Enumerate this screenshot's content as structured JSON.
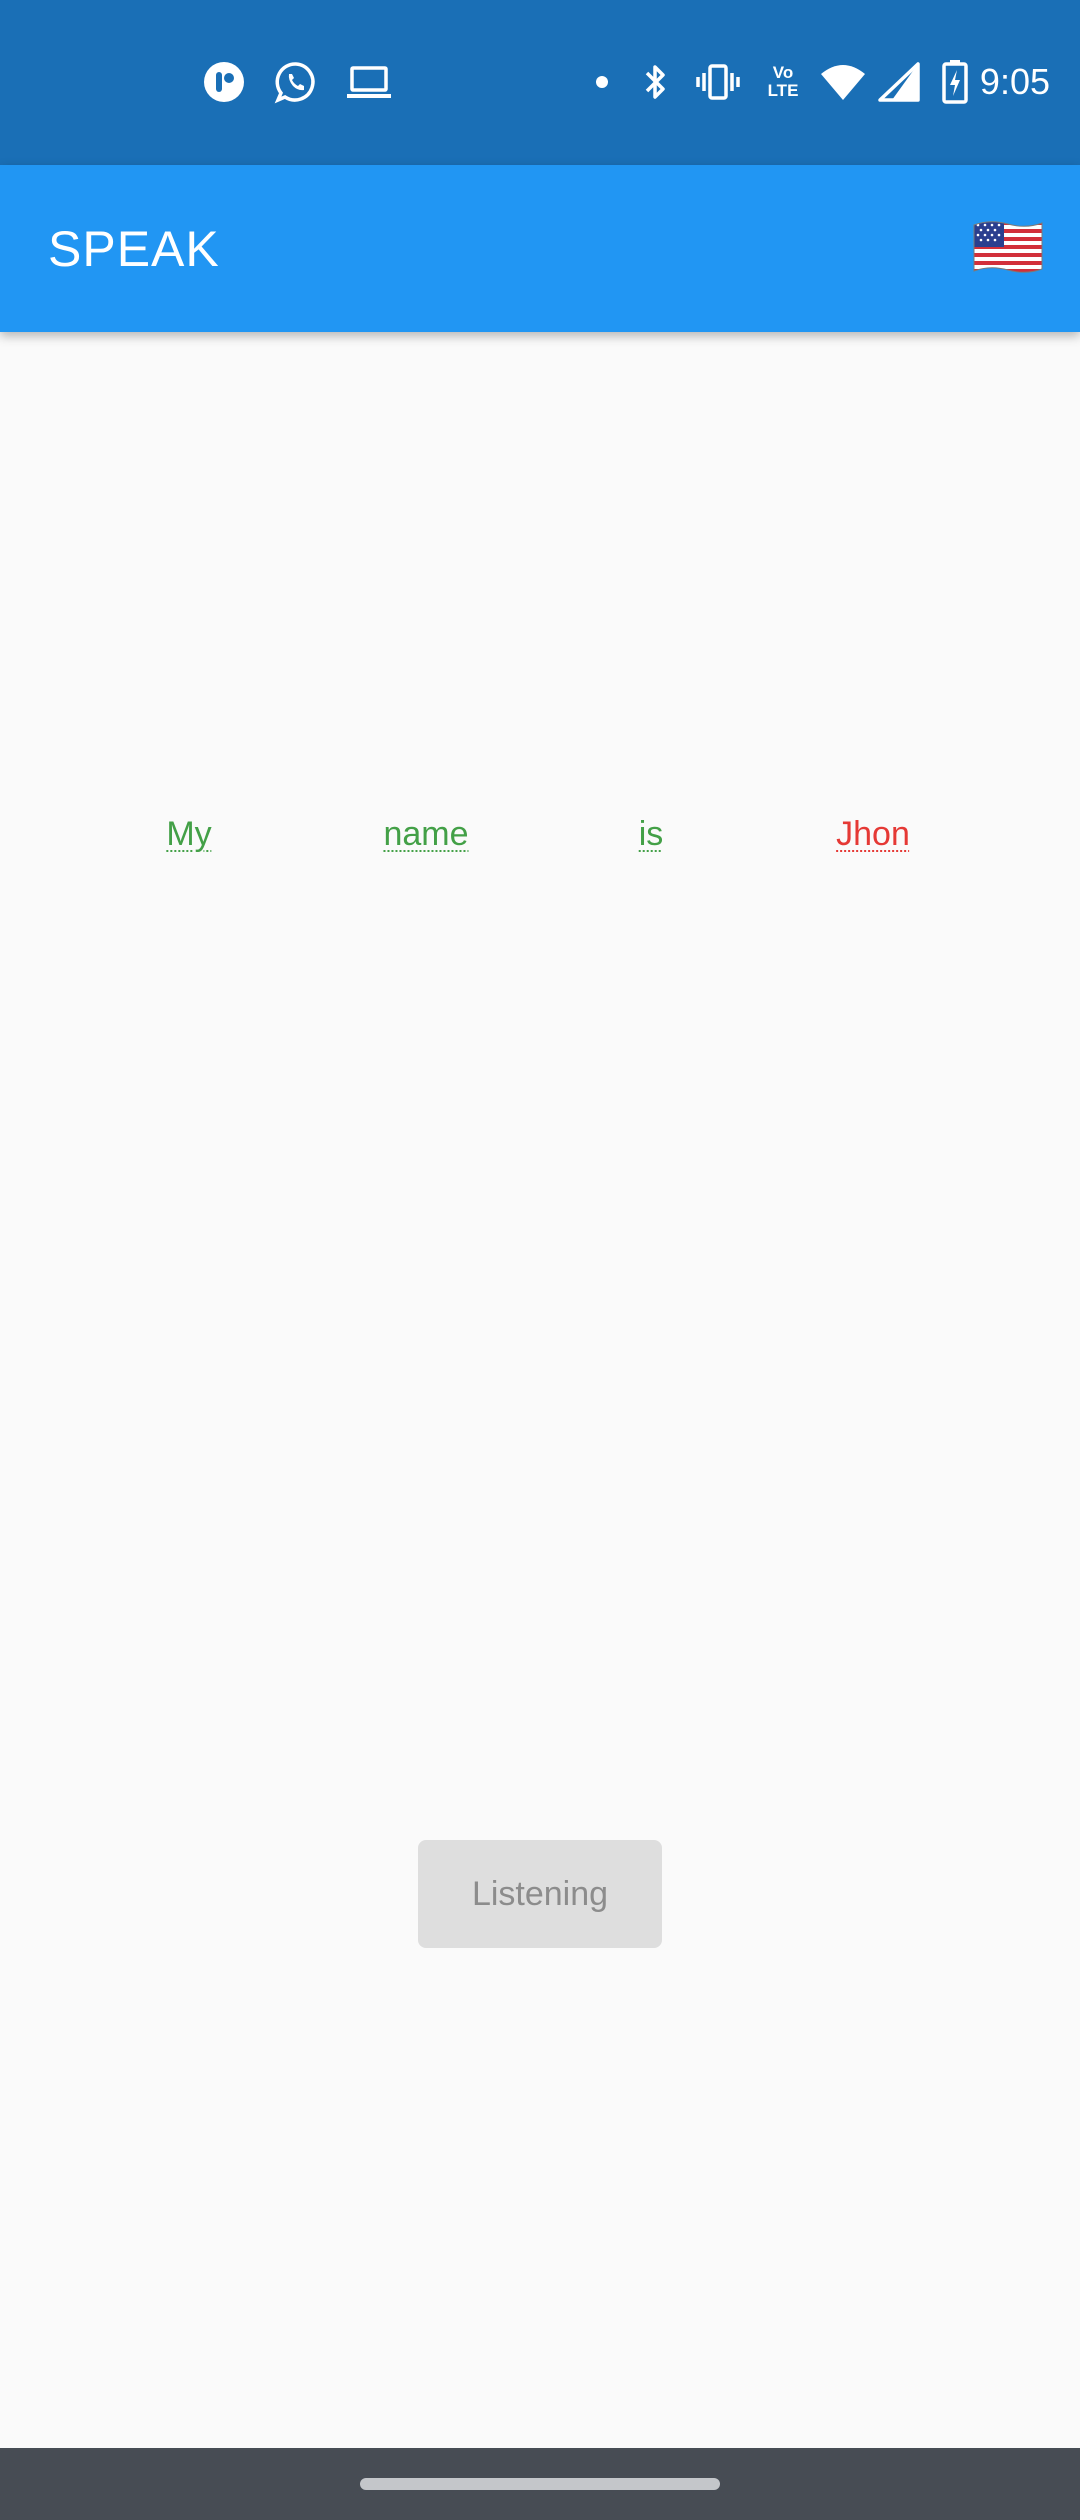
{
  "status_bar": {
    "time": "9:05",
    "left_icons": [
      "app-notification-icon",
      "whatsapp-icon",
      "laptop-icon"
    ],
    "right_icons": [
      "dot-icon",
      "bluetooth-icon",
      "vibrate-icon",
      "volte-icon",
      "wifi-icon",
      "signal-icon",
      "battery-charging-icon"
    ],
    "volte_label": "Vo LTE",
    "bg_color": "#1a6fb6"
  },
  "app_bar": {
    "title": "SPEAK",
    "language_flag": "us-flag-icon",
    "bg_color": "#2196f3"
  },
  "main": {
    "words": [
      {
        "text": "My",
        "status": "correct",
        "color": "#43a047"
      },
      {
        "text": "name",
        "status": "correct",
        "color": "#43a047"
      },
      {
        "text": "is",
        "status": "correct",
        "color": "#43a047"
      },
      {
        "text": "Jhon",
        "status": "incorrect",
        "color": "#e53935"
      }
    ],
    "listening_button_label": "Listening"
  },
  "nav_bar": {
    "bg_color": "#474c54"
  }
}
